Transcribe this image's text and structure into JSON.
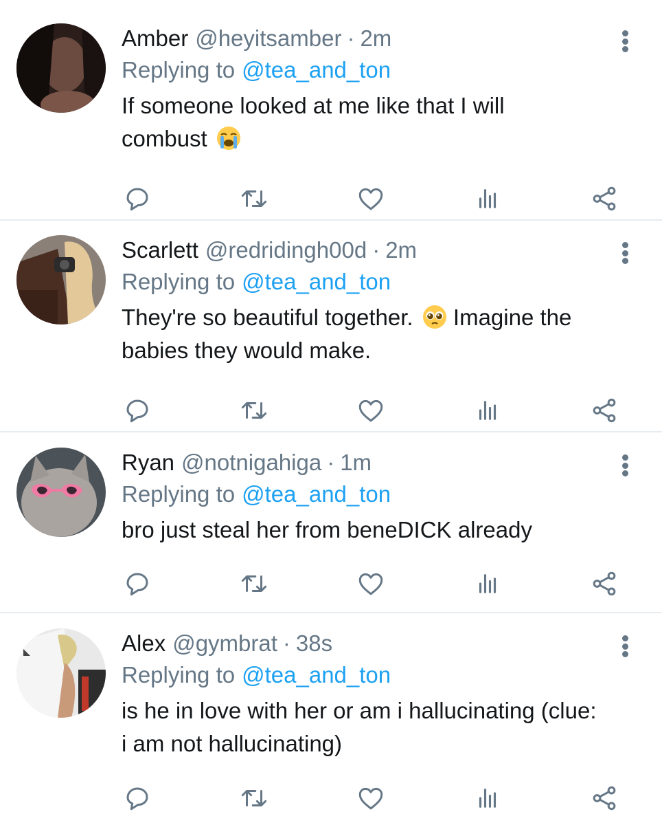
{
  "tweets": [
    {
      "name": "Amber",
      "handle": "@heyitsamber",
      "separator": "·",
      "time": "2m",
      "replying_prefix": "Replying to",
      "replying_to": "@tea_and_ton",
      "text": "If someone looked at me like that I will combust",
      "emoji": "loudly-crying-face"
    },
    {
      "name": "Scarlett",
      "handle": "@redridingh00d",
      "separator": "·",
      "time": "2m",
      "replying_prefix": "Replying to",
      "replying_to": "@tea_and_ton",
      "text_before": "They're so beautiful together.",
      "emoji": "pleading-face",
      "text_after": "Imagine the babies they would make."
    },
    {
      "name": "Ryan",
      "handle": "@notnigahiga",
      "separator": "·",
      "time": "1m",
      "replying_prefix": "Replying to",
      "replying_to": "@tea_and_ton",
      "text": "bro just steal her from beneDICK already"
    },
    {
      "name": "Alex",
      "handle": "@gymbrat",
      "separator": "·",
      "time": "38s",
      "replying_prefix": "Replying to",
      "replying_to": "@tea_and_ton",
      "text": "is he in love with her or am i hallucinating (clue: i am not hallucinating)"
    }
  ],
  "icons": {
    "reply": "reply-icon",
    "retweet": "retweet-icon",
    "like": "heart-icon",
    "stats": "analytics-icon",
    "share": "share-icon",
    "more": "more-vertical-icon"
  },
  "colors": {
    "text": "#14171a",
    "secondary": "#657786",
    "link": "#1da1f2",
    "divider": "#e6ecf0"
  }
}
